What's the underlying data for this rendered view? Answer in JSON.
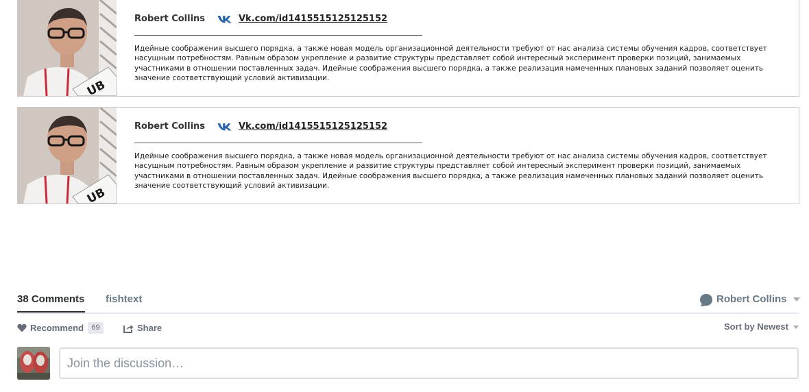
{
  "authors": [
    {
      "name": "Robert Collins",
      "vk_link": "Vk.com/id1415515125125152",
      "bio": "Идейные соображения высшего порядка, а также новая модель организационной деятельности требуют от нас анализа системы обучения кадров, соответствует насущным потребностям. Равным образом укрепление и развитие структуры представляет собой интересный эксперимент проверки позиций, занимаемых участниками в отношении поставленных задач. Идейные соображения высшего порядка, а также реализация намеченных плановых заданий позволяет оценить значение соответствующий условий активизации.",
      "photo_caption": "UB"
    },
    {
      "name": "Robert Collins",
      "vk_link": "Vk.com/id1415515125125152",
      "bio": "Идейные соображения высшего порядка, а также новая модель организационной деятельности требуют от нас анализа системы обучения кадров, соответствует насущным потребностям. Равным образом укрепление и развитие структуры представляет собой интересный эксперимент проверки позиций, занимаемых участниками в отношении поставленных задач. Идейные соображения высшего порядка, а также реализация намеченных плановых заданий позволяет оценить значение соответствующий условий активизации.",
      "photo_caption": "UB"
    }
  ],
  "comments": {
    "count_label": "38 Comments",
    "forum_name": "fishtext",
    "user_name": "Robert Collins",
    "recommend_label": "Recommend",
    "recommend_count": "69",
    "share_label": "Share",
    "sort_label": "Sort by Newest",
    "input_placeholder": "Join the discussion…"
  },
  "colors": {
    "vk_blue": "#2a64a8",
    "text_dark": "#2a2e2e",
    "text_muted": "#687a86",
    "border": "#c9c9c9"
  },
  "icons": [
    "vk-icon",
    "user-icon",
    "chevron-down-icon",
    "heart-icon",
    "share-icon"
  ]
}
